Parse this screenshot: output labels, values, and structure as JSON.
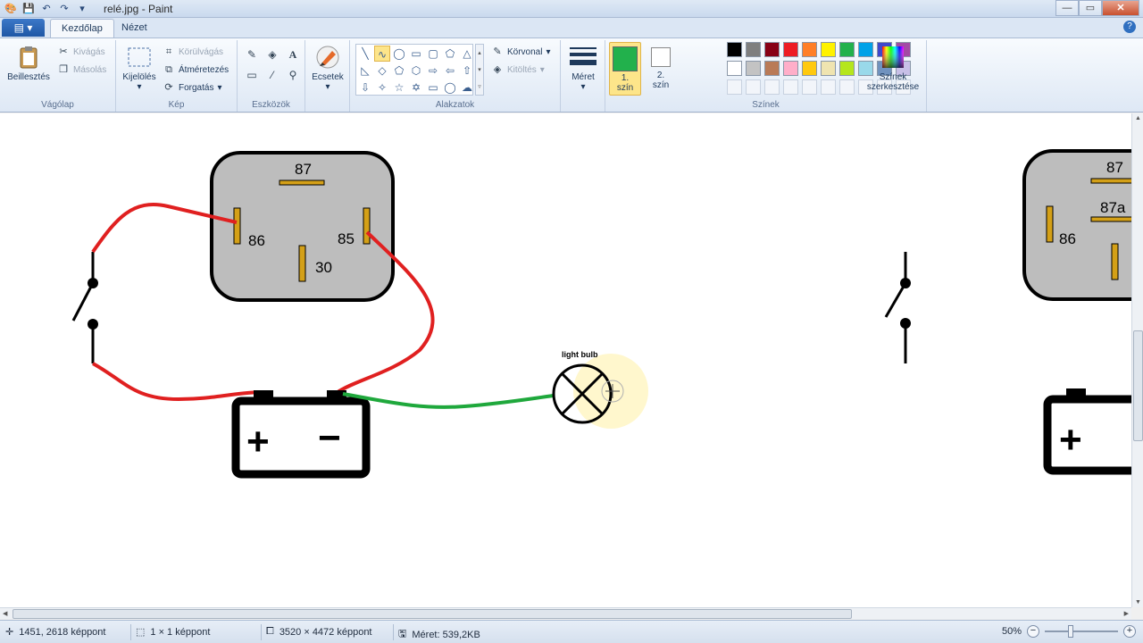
{
  "window": {
    "title": "relé.jpg - Paint",
    "controls": {
      "minimize": "—",
      "maximize": "▭",
      "close": "✕"
    }
  },
  "quick_access": [
    "save-icon",
    "undo-icon",
    "redo-icon",
    "customize-icon"
  ],
  "tabs": {
    "app_menu": "▤ ▾",
    "home": "Kezdőlap",
    "view": "Nézet",
    "help": "?"
  },
  "ribbon": {
    "clipboard": {
      "paste": "Beillesztés",
      "cut": "Kivágás",
      "copy": "Másolás",
      "label": "Vágólap"
    },
    "image": {
      "select": "Kijelölés",
      "crop": "Körülvágás",
      "resize": "Átméretezés",
      "rotate": "Forgatás",
      "label": "Kép"
    },
    "tools": {
      "label": "Eszközök"
    },
    "brushes": {
      "label": "Ecsetek"
    },
    "shapes": {
      "outline": "Körvonal",
      "fill": "Kitöltés",
      "label": "Alakzatok"
    },
    "size": {
      "label": "Méret"
    },
    "colors": {
      "color1_line1": "1.",
      "color1_line2": "szín",
      "color2_line1": "2.",
      "color2_line2": "szín",
      "edit_line1": "Színek",
      "edit_line2": "szerkesztése",
      "label": "Színek",
      "color1_value": "#22b14c",
      "color2_value": "#ffffff",
      "row1": [
        "#000000",
        "#7f7f7f",
        "#880015",
        "#ed1c24",
        "#ff7f27",
        "#fff200",
        "#22b14c",
        "#00a2e8",
        "#3f48cc",
        "#a349a4"
      ],
      "row2": [
        "#ffffff",
        "#c3c3c3",
        "#b97a57",
        "#ffaec9",
        "#ffc90e",
        "#efe4b0",
        "#b5e61d",
        "#99d9ea",
        "#7092be",
        "#c8bfe7"
      ]
    }
  },
  "diagram": {
    "relay_left": {
      "pin_87": "87",
      "pin_86": "86",
      "pin_85": "85",
      "pin_30": "30"
    },
    "relay_right": {
      "pin_87": "87",
      "pin_87a": "87a",
      "pin_86": "86"
    },
    "battery_plus": "+",
    "battery_minus": "−",
    "bulb_label": "light bulb",
    "wire_red": "#e02020",
    "wire_green": "#1fa83c",
    "relay_fill": "#bdbdbd",
    "pin_color": "#d4a017"
  },
  "status": {
    "cursor_pos": "1451, 2618 képpont",
    "selection_size": "1 × 1 képpont",
    "image_size": "3520 × 4472 képpont",
    "file_size": "Méret: 539,2KB",
    "zoom": "50%"
  }
}
